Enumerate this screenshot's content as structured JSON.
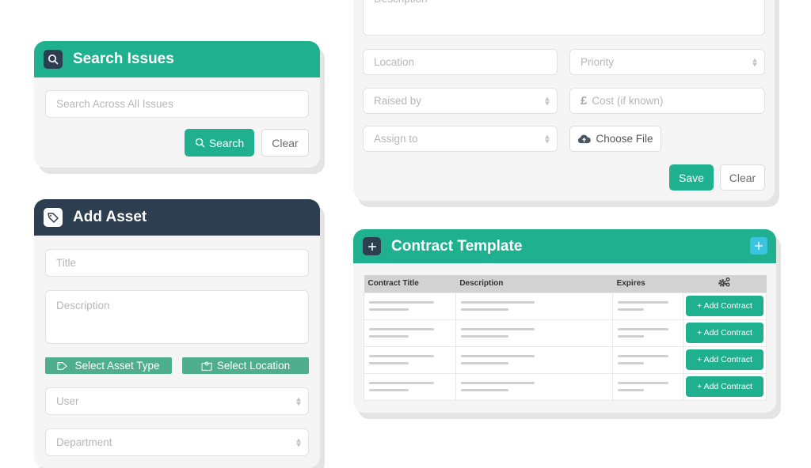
{
  "colors": {
    "teal": "#1fb08f",
    "navy": "#2d3e50",
    "flat_green": "#4fae8d",
    "cyan": "#3cc3e0"
  },
  "search_issues": {
    "title": "Search Issues",
    "icon": "search-icon",
    "search_placeholder": "Search Across All Issues",
    "search_button": "Search",
    "clear_button": "Clear"
  },
  "add_asset": {
    "title": "Add Asset",
    "icon": "tag-icon",
    "title_placeholder": "Title",
    "description_placeholder": "Description",
    "select_asset_type": "Select Asset Type",
    "select_location": "Select Location",
    "user_placeholder": "User",
    "department_placeholder": "Department"
  },
  "issue_form": {
    "description_placeholder": "Description",
    "location_placeholder": "Location",
    "priority_placeholder": "Priority",
    "raised_by_placeholder": "Raised by",
    "cost_placeholder": "Cost (if known)",
    "cost_currency": "£",
    "assign_to_placeholder": "Assign to",
    "choose_file": "Choose File",
    "save_button": "Save",
    "clear_button": "Clear"
  },
  "contract_template": {
    "title": "Contract Template",
    "columns": [
      "Contract Title",
      "Description",
      "Expires",
      "settings-icon"
    ],
    "rows": [
      {
        "action": "+ Add Contract"
      },
      {
        "action": "+ Add Contract"
      },
      {
        "action": "+ Add Contract"
      },
      {
        "action": "+ Add Contract"
      }
    ]
  }
}
